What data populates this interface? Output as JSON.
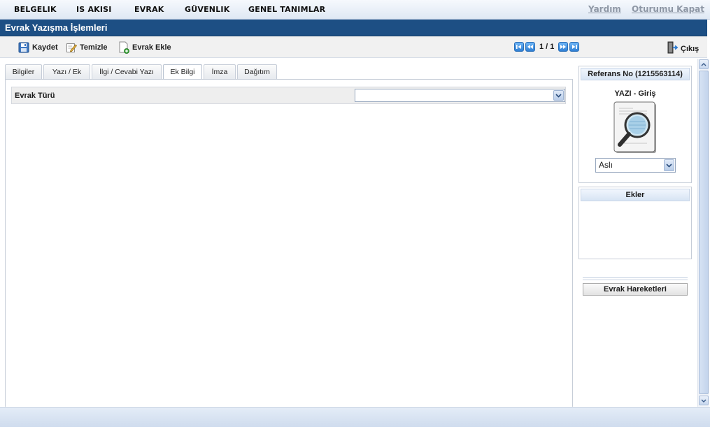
{
  "menu": {
    "items": [
      "BELGELIK",
      "IS AKISI",
      "EVRAK",
      "GÜVENLIK",
      "GENEL TANIMLAR"
    ],
    "help_link": "Yardım",
    "logout_link": "Oturumu Kapat"
  },
  "page": {
    "title": "Evrak Yazışma İşlemleri"
  },
  "toolbar": {
    "save_label": "Kaydet",
    "clear_label": "Temizle",
    "add_label": "Evrak Ekle",
    "pager_text": "1 / 1",
    "exit_label": "Çıkış"
  },
  "tabs": [
    "Bilgiler",
    "Yazı / Ek",
    "İlgi / Cevabi Yazı",
    "Ek Bilgi",
    "İmza",
    "Dağıtım"
  ],
  "active_tab": "Ek Bilgi",
  "form": {
    "doc_type_label": "Evrak Türü",
    "doc_type_value": ""
  },
  "side": {
    "reference_label": "Referans No (1215563114)",
    "doc_kind": "YAZI - Giriş",
    "copy_select_value": "Aslı",
    "attachments_title": "Ekler",
    "actions_button": "Evrak Hareketleri"
  },
  "colors": {
    "title_bar": "#1d4f84",
    "pager_button": "#2f7fd4",
    "link_gray": "#8e97a5"
  },
  "icons": {
    "save": "floppy-disk-icon",
    "clear": "pencil-note-icon",
    "add": "document-add-icon",
    "exit": "door-exit-icon",
    "preview": "magnifier-document-icon"
  }
}
